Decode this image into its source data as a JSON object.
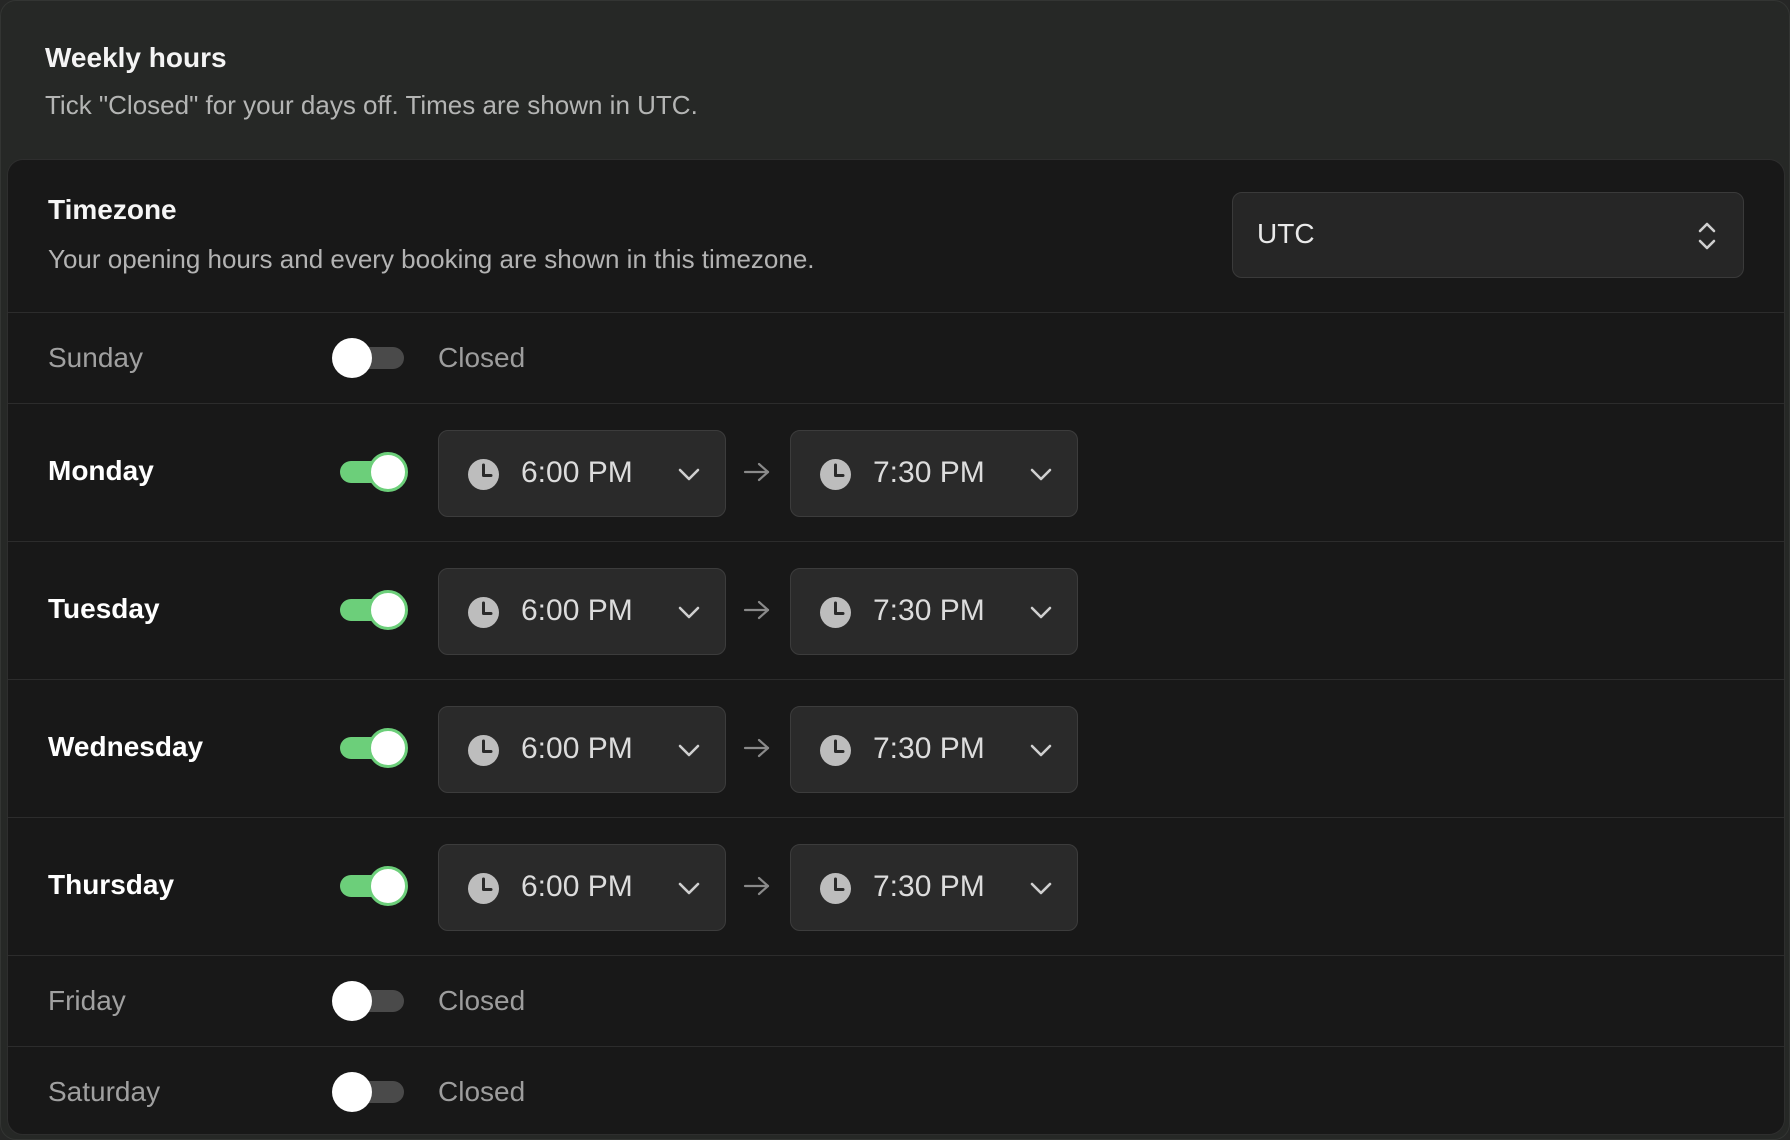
{
  "section": {
    "title": "Weekly hours",
    "subtitle": "Tick \"Closed\" for your days off. Times are shown in UTC."
  },
  "timezone": {
    "title": "Timezone",
    "description": "Your opening hours and every booking are shown in this timezone.",
    "selected": "UTC",
    "icon": "chevron-up-down-icon"
  },
  "closed_label": "Closed",
  "days": [
    {
      "name": "Sunday",
      "open": false
    },
    {
      "name": "Monday",
      "open": true,
      "start": "6:00 PM",
      "end": "7:30 PM"
    },
    {
      "name": "Tuesday",
      "open": true,
      "start": "6:00 PM",
      "end": "7:30 PM"
    },
    {
      "name": "Wednesday",
      "open": true,
      "start": "6:00 PM",
      "end": "7:30 PM"
    },
    {
      "name": "Thursday",
      "open": true,
      "start": "6:00 PM",
      "end": "7:30 PM"
    },
    {
      "name": "Friday",
      "open": false
    },
    {
      "name": "Saturday",
      "open": false
    }
  ],
  "colors": {
    "accent": "#6ccf7a",
    "card_bg": "#181818",
    "outer_bg": "#262826"
  }
}
